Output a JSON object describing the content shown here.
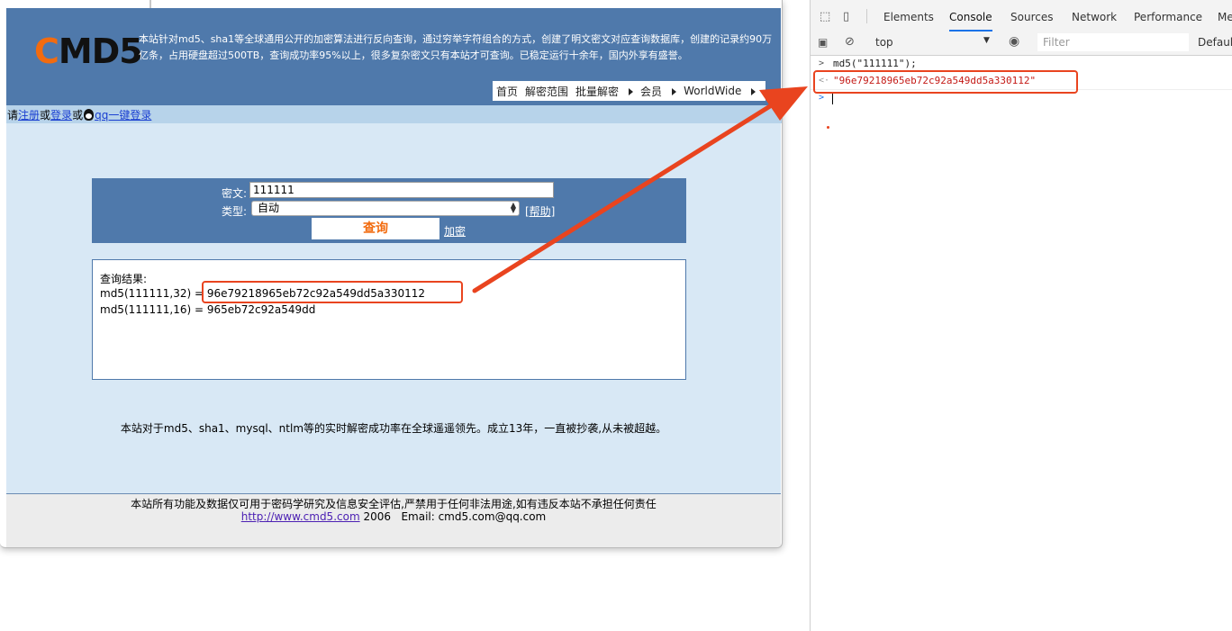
{
  "site": {
    "logo_c": "C",
    "logo_rest": "MD5",
    "intro": "本站针对md5、sha1等全球通用公开的加密算法进行反向查询，通过穷举字符组合的方式，创建了明文密文对应查询数据库，创建的记录约90万亿条，占用硬盘超过500TB，查询成功率95%以上，很多复杂密文只有本站才可查询。已稳定运行十余年，国内外享有盛誉。",
    "nav": [
      "首页",
      "解密范围",
      "批量解密",
      "会员",
      "WorldWide"
    ],
    "login": {
      "prefix": "请",
      "register": "注册",
      "or1": "或",
      "login": "登录",
      "or2": "或",
      "qq_login": "qq一键登录"
    },
    "form": {
      "cipher_label": "密文:",
      "cipher_value": "111111",
      "type_label": "类型:",
      "type_value": "自动",
      "help": "[帮助]",
      "query_button": "查询",
      "encrypt_link": "加密"
    },
    "result": {
      "title": "查询结果:",
      "line1_prefix": "md5(111111,32) = ",
      "line1_value": "96e79218965eb72c92a549dd5a330112",
      "line2": "md5(111111,16) = 965eb72c92a549dd"
    },
    "claim": "本站对于md5、sha1、mysql、ntlm等的实时解密成功率在全球遥遥领先。成立13年，一直被抄袭,从未被超越。",
    "footer": {
      "notice": "本站所有功能及数据仅可用于密码学研究及信息安全评估,严禁用于任何非法用途,如有违反本站不承担任何责任",
      "url": "http://www.cmd5.com",
      "year": " 2006   ",
      "email": "Email: cmd5.com@qq.com"
    }
  },
  "devtools": {
    "tabs": [
      "Elements",
      "Console",
      "Sources",
      "Network",
      "Performance",
      "Me"
    ],
    "active_tab": "Console",
    "context": "top",
    "filter_placeholder": "Filter",
    "levels": "Default",
    "console": {
      "command": "md5(\"111111\");",
      "output": "\"96e79218965eb72c92a549dd5a330112\""
    }
  },
  "colors": {
    "header_blue": "#4f79ab",
    "content_bg": "#d8e8f5",
    "accent_orange": "#f26b0f",
    "annotation_red": "#e9441f",
    "console_string": "#c41a16"
  }
}
